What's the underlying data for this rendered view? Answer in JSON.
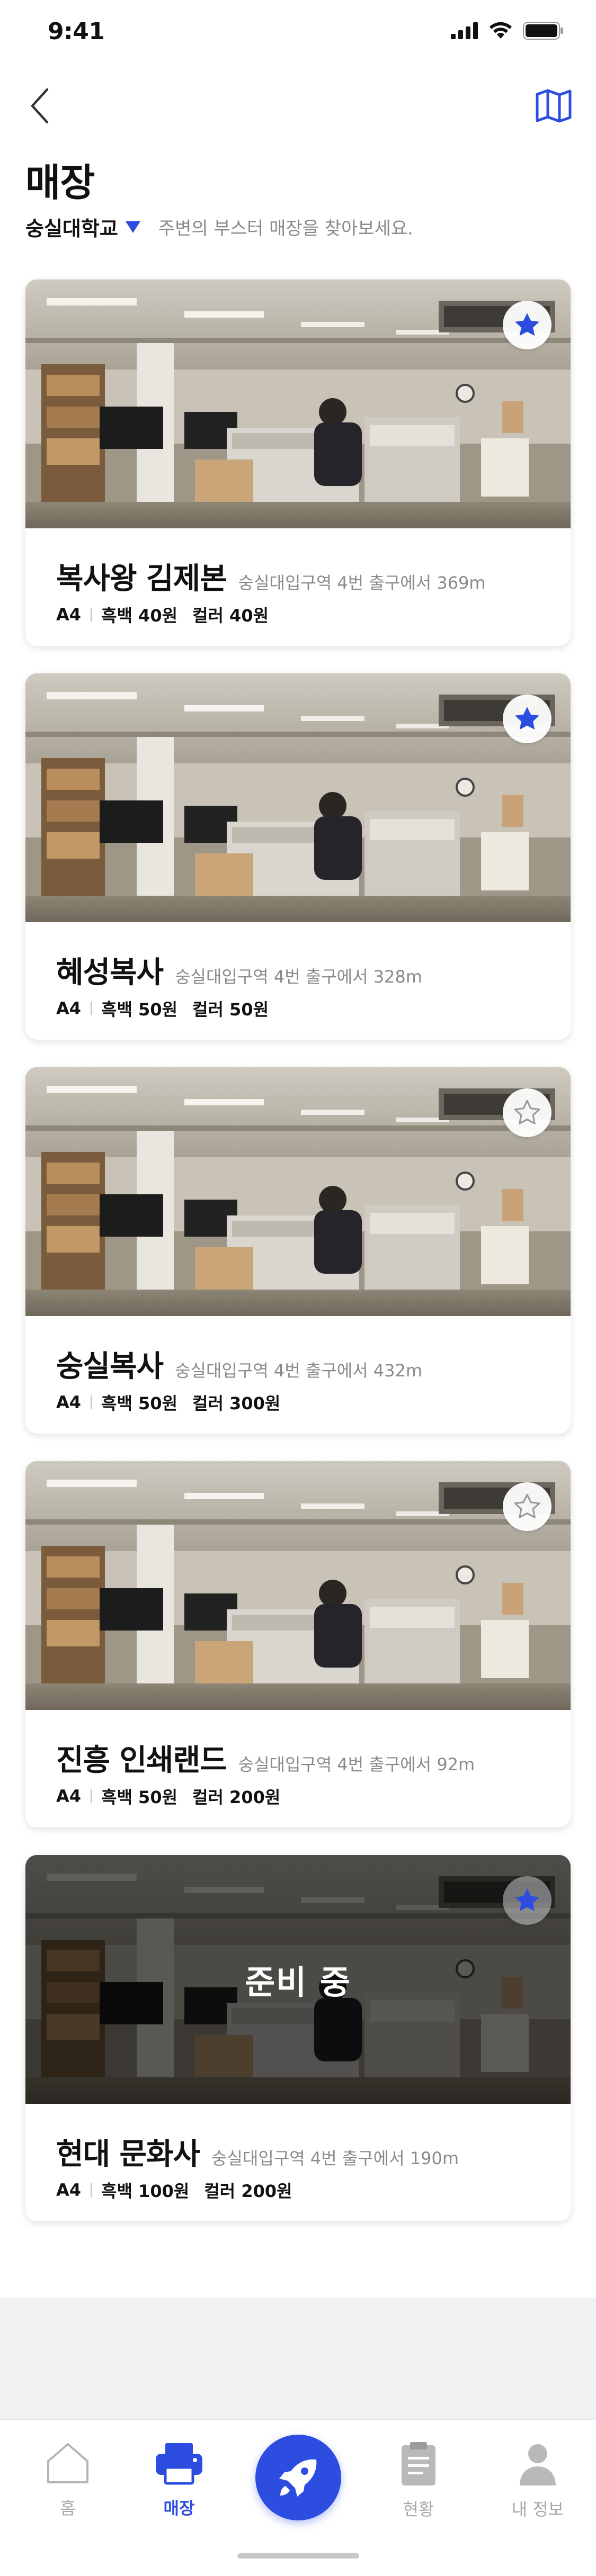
{
  "status_bar": {
    "time": "9:41"
  },
  "header": {
    "title": "매장",
    "location": "숭실대학교",
    "hint": "주변의 부스터 매장을 찾아보세요."
  },
  "stores": [
    {
      "name": "복사왕 김제본",
      "distance": "숭실대입구역 4번 출구에서 369m",
      "paper": "A4",
      "bw": "흑백 40원",
      "color": "컬러 40원",
      "favorite": true
    },
    {
      "name": "혜성복사",
      "distance": "숭실대입구역 4번 출구에서 328m",
      "paper": "A4",
      "bw": "흑백 50원",
      "color": "컬러 50원",
      "favorite": true
    },
    {
      "name": "숭실복사",
      "distance": "숭실대입구역 4번 출구에서 432m",
      "paper": "A4",
      "bw": "흑백 50원",
      "color": "컬러 300원",
      "favorite": false
    },
    {
      "name": "진흥 인쇄랜드",
      "distance": "숭실대입구역 4번 출구에서 92m",
      "paper": "A4",
      "bw": "흑백 50원",
      "color": "컬러 200원",
      "favorite": false
    },
    {
      "name": "현대 문화사",
      "distance": "숭실대입구역 4번 출구에서 190m",
      "paper": "A4",
      "bw": "흑백 100원",
      "color": "컬러 200원",
      "favorite": true,
      "overlay": "준비 중"
    }
  ],
  "tab_bar": {
    "home": "홈",
    "store": "매장",
    "status": "현황",
    "profile": "내 정보"
  },
  "colors": {
    "accent": "#2d4de0",
    "muted": "#8a8a8a"
  },
  "icons": [
    "back-arrow-icon",
    "map-icon",
    "star-filled-icon",
    "star-outline-icon",
    "home-icon",
    "printer-icon",
    "rocket-icon",
    "clipboard-icon",
    "person-icon"
  ]
}
